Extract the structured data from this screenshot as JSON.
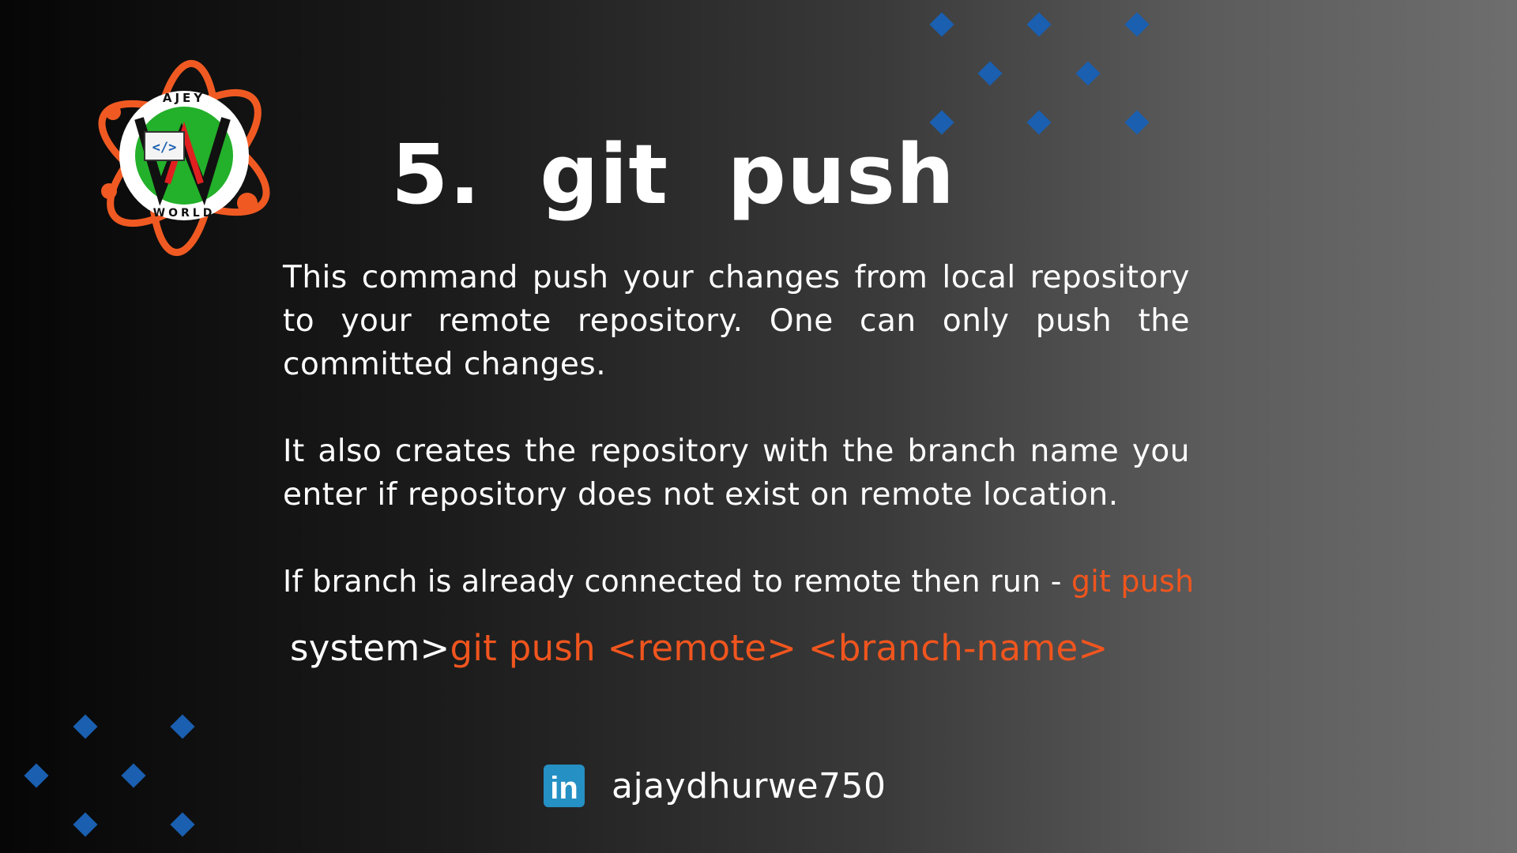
{
  "logo": {
    "top_text": "AJEY",
    "bottom_text": "WORLD",
    "code_glyph": "</>",
    "letter": "W"
  },
  "title": "5.  git  push",
  "paragraph1": "This command push your changes from local repository to your remote repository. One can only push the committed changes.",
  "paragraph2": "It also creates the repository with the branch name you enter if repository does not exist on remote location.",
  "paragraph3": {
    "text": "If branch is already connected to remote then run - ",
    "command": "git push"
  },
  "command_line": {
    "prefix": "system>",
    "command": "git push <remote> <branch-name>"
  },
  "social": {
    "icon": "linkedin-icon",
    "icon_text": "in",
    "handle": "ajaydhurwe750"
  },
  "colors": {
    "accent": "#f0551e",
    "diamond": "#1a5fb0",
    "linkedin": "#2590c4"
  }
}
